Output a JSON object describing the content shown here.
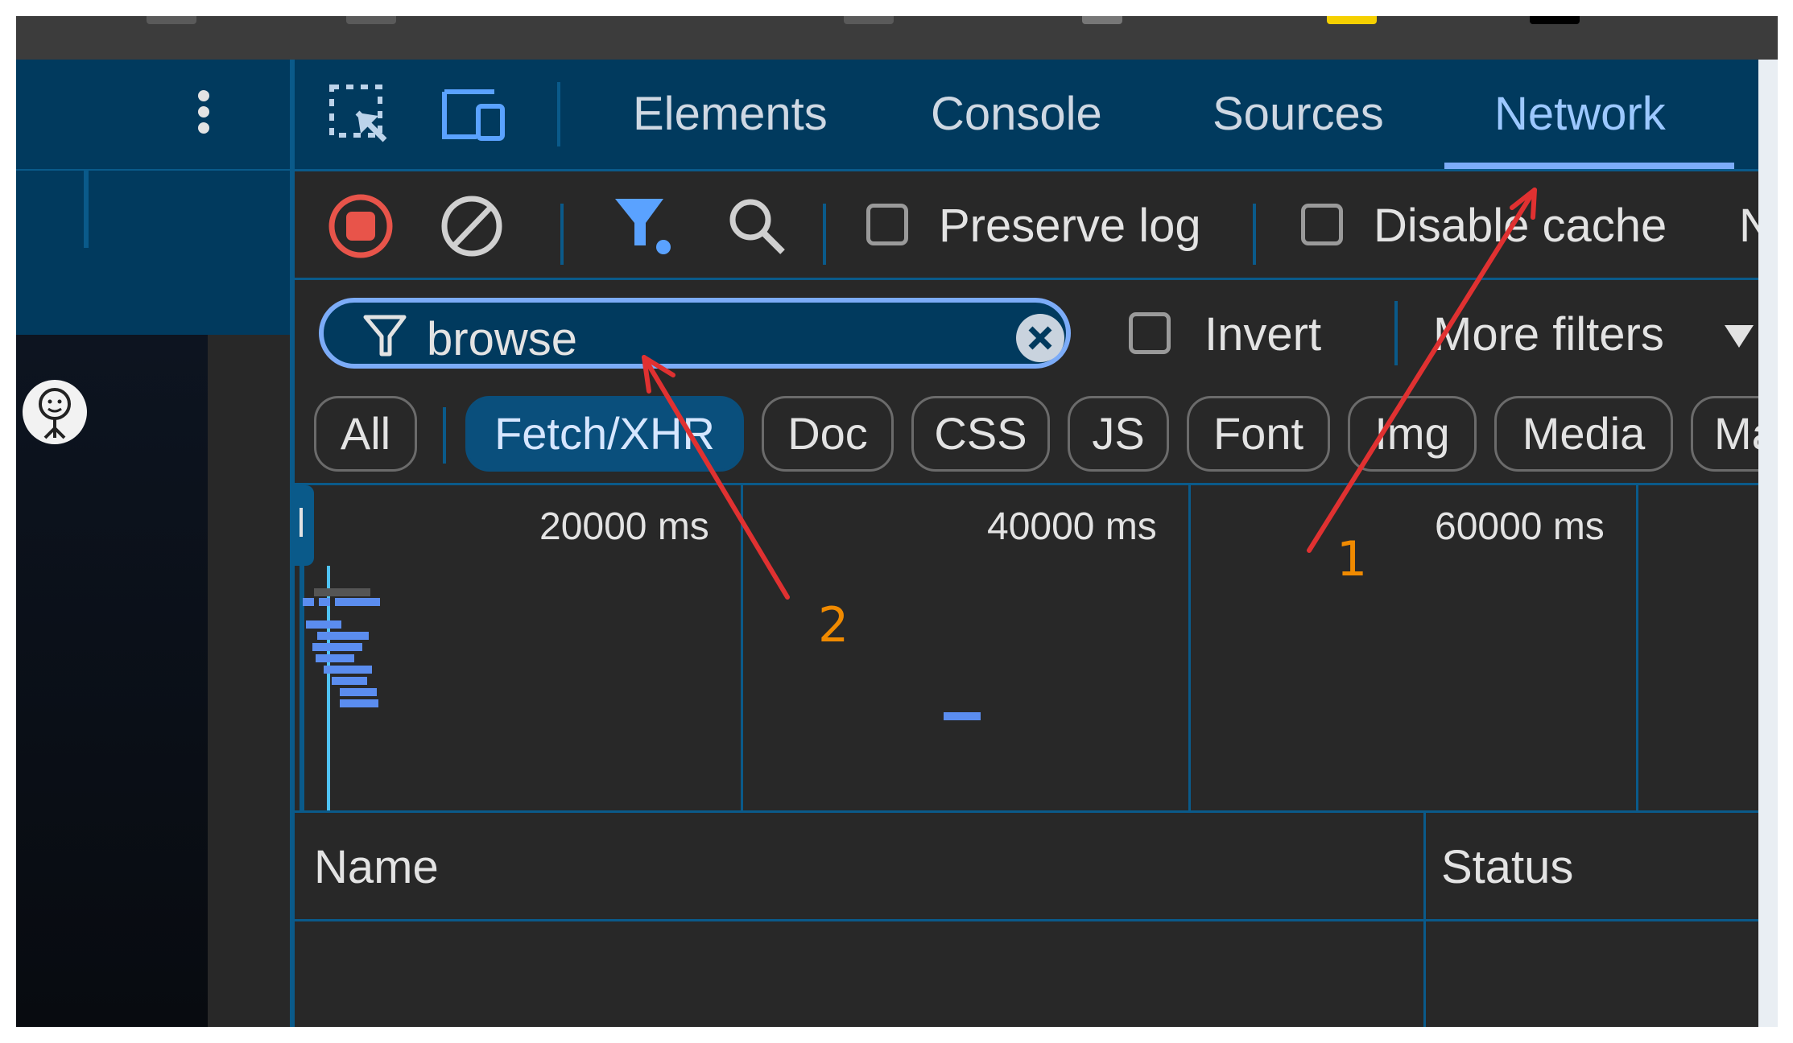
{
  "devtools": {
    "tabs": [
      {
        "label": "Elements",
        "active": false
      },
      {
        "label": "Console",
        "active": false
      },
      {
        "label": "Sources",
        "active": false
      },
      {
        "label": "Network",
        "active": true
      }
    ],
    "toolbar": {
      "preserve_log_label": "Preserve log",
      "preserve_log_checked": false,
      "disable_cache_label": "Disable cache",
      "throttle_partial": "No"
    },
    "filter": {
      "value": "browse",
      "invert_label": "Invert",
      "more_filters_label": "More filters"
    },
    "type_filters": [
      {
        "label": "All",
        "active": false
      },
      {
        "label": "Fetch/XHR",
        "active": true
      },
      {
        "label": "Doc",
        "active": false
      },
      {
        "label": "CSS",
        "active": false
      },
      {
        "label": "JS",
        "active": false
      },
      {
        "label": "Font",
        "active": false
      },
      {
        "label": "Img",
        "active": false
      },
      {
        "label": "Media",
        "active": false
      },
      {
        "label": "Man",
        "active": false
      }
    ],
    "overview": {
      "ticks": [
        "20000 ms",
        "40000 ms",
        "60000 ms"
      ]
    },
    "table": {
      "columns": [
        "Name",
        "Status"
      ]
    }
  },
  "annotations": {
    "step1": "1",
    "step2": "2"
  },
  "colors": {
    "accent": "#7cacf8",
    "panel_blue": "#013a5e",
    "record_red": "#e8544a",
    "annotation_arrow": "#e03131",
    "annotation_text": "#f08a00"
  }
}
